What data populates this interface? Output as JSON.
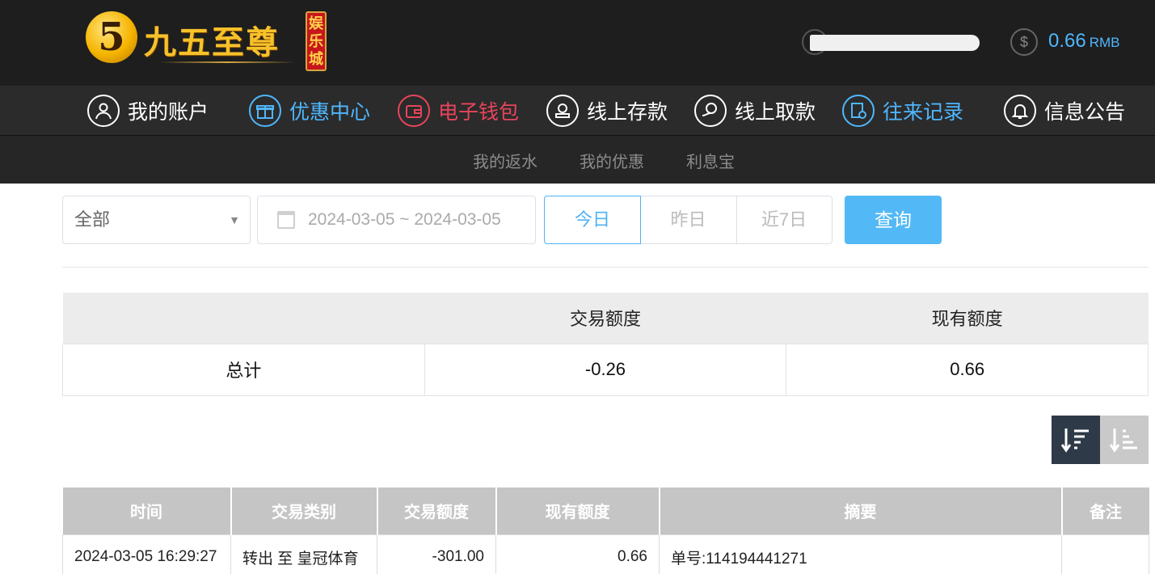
{
  "brand": {
    "logo_char": "5",
    "name": "九五至尊",
    "badge": "娱乐城"
  },
  "account": {
    "balance": "0.66",
    "currency": "RMB",
    "accent_color": "#4fb7ff"
  },
  "main_nav": [
    {
      "label": "我的账户",
      "icon": "user-icon",
      "color": "#ffffff"
    },
    {
      "label": "优惠中心",
      "icon": "gift-icon",
      "color": "#4fb7ff"
    },
    {
      "label": "电子钱包",
      "icon": "wallet-icon",
      "color": "#e8445a"
    },
    {
      "label": "线上存款",
      "icon": "deposit-icon",
      "color": "#ffffff"
    },
    {
      "label": "线上取款",
      "icon": "withdraw-icon",
      "color": "#ffffff"
    },
    {
      "label": "往来记录",
      "icon": "records-icon",
      "color": "#4fb7ff"
    },
    {
      "label": "信息公告",
      "icon": "bell-icon",
      "color": "#ffffff"
    }
  ],
  "sub_nav": [
    "我的返水",
    "我的优惠",
    "利息宝"
  ],
  "filters": {
    "type_select": "全部",
    "date_range": "2024-03-05 ~ 2024-03-05",
    "quick_dates": [
      "今日",
      "昨日",
      "近7日"
    ],
    "active_quick_date": "今日",
    "query_label": "查询"
  },
  "summary": {
    "headers": [
      "",
      "交易额度",
      "现有额度"
    ],
    "row": {
      "label": "总计",
      "transaction": "-0.26",
      "current": "0.66"
    }
  },
  "records": {
    "headers": [
      "时间",
      "交易类别",
      "交易额度",
      "现有额度",
      "摘要",
      "备注"
    ],
    "rows": [
      {
        "time": "2024-03-05 16:29:27",
        "type": "转出 至 皇冠体育",
        "amount": "-301.00",
        "balance": "0.66",
        "summary": "单号:114194441271",
        "note": ""
      }
    ]
  }
}
